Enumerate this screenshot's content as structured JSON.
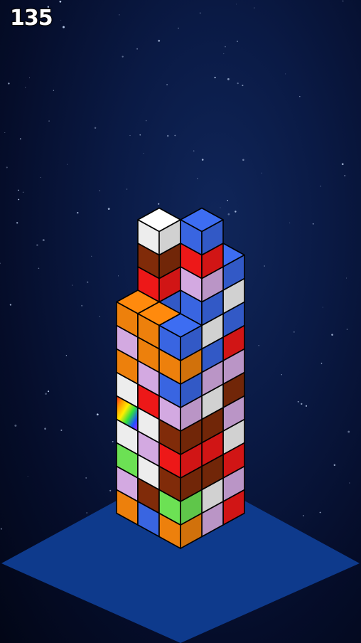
{
  "hud": {
    "score": "135"
  },
  "colors": {
    "white": "#ffffff",
    "red": "#ff1a1a",
    "blue": "#3d6df2",
    "green": "#74f25a",
    "orange": "#ff8a0d",
    "brown": "#8a2e0a",
    "lavender": "#e3b6f2",
    "platform": "#0e3a8c",
    "space": "#0a1a45"
  },
  "board": {
    "columns": [
      [
        "orange",
        "blue",
        "brown",
        "white",
        "brown",
        "orange",
        "blue",
        "white",
        "green"
      ],
      [
        "lavender",
        "green",
        "lavender",
        "brown",
        "white",
        "lavender",
        "blue"
      ],
      [
        "red",
        "lavender",
        "red",
        "white",
        "lavender",
        "brown",
        "lavender",
        "red",
        "blue",
        "white",
        "blue"
      ],
      [
        "orange",
        "white",
        "blue",
        "lavender",
        "lavender",
        "rainbow",
        "brown",
        "lavender",
        "blue",
        "red",
        "brown",
        "white"
      ],
      [
        "lavender",
        "white",
        "brown",
        "red",
        "brown",
        "white",
        "lavender",
        "blue",
        "white",
        "blue",
        "lavender",
        "red",
        "blue"
      ],
      [
        "orange",
        "lavender",
        "green",
        "white",
        "rainbow",
        "white",
        "orange",
        "lavender",
        "orange"
      ],
      [
        "blue",
        "brown",
        "white",
        "lavender",
        "white",
        "red",
        "lavender",
        "orange",
        "orange"
      ],
      [
        "orange",
        "green",
        "brown",
        "red",
        "brown",
        "lavender",
        "blue",
        "orange",
        "blue"
      ]
    ]
  }
}
